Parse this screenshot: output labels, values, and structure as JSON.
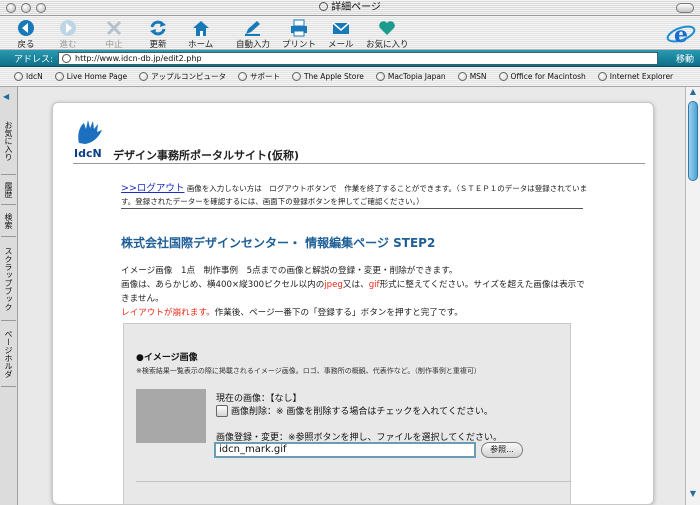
{
  "window": {
    "title": "詳細ページ"
  },
  "toolbar": {
    "back": "戻る",
    "forward": "進む",
    "stop": "中止",
    "refresh": "更新",
    "home": "ホーム",
    "autofill": "自動入力",
    "print": "プリント",
    "mail": "メール",
    "favorites": "お気に入り"
  },
  "address": {
    "label": "アドレス:",
    "url": "http://www.idcn-db.jp/edit2.php",
    "go": "移動"
  },
  "favbar": {
    "items": [
      "IdcN",
      "Live Home Page",
      "アップルコンピュータ",
      "サポート",
      "The Apple Store",
      "MacTopia Japan",
      "MSN",
      "Office for Macintosh",
      "Internet Explorer"
    ]
  },
  "sidebar": {
    "tabs": [
      "お気に入り",
      "履歴",
      "検索",
      "スクラップブック",
      "ページホルダ"
    ]
  },
  "page": {
    "logo_text": "IdcN",
    "site_title": "デザイン事務所ポータルサイト(仮称)",
    "logout_link": ">>ログアウト",
    "logout_desc": "画像を入力しない方は　ログアウトボタンで　作業を終了することができます。（ＳＴＥＰ１のデータは登録されています。登録されたデーターを確認するには、画面下の登録ボタンを押してご確認ください。）",
    "section_title": "株式会社国際デザインセンター・ 情報編集ページ STEP2",
    "intro1": "イメージ画像　1点　制作事例　5点までの画像と解説の登録・変更・削除ができます。",
    "intro2a": "画像は、あらかじめ、横400×縦300ピクセル以内の",
    "intro2_jpeg": "jpeg",
    "intro2b": "又は、",
    "intro2_gif": "gif",
    "intro2c": "形式に整えてください。サイズを超えた画像は表示できません。",
    "intro3_red": "レイアウトが崩れます。",
    "intro3b": "作業後、ページ一番下の「登録する」ボタンを押すと完了です。"
  },
  "form": {
    "heading": "●イメージ画像",
    "note": "※検索結果一覧表示の際に掲載されるイメージ画像。ロゴ、事務所の概観、代表作など。（制作事例と重複可）",
    "current": "現在の画像：【なし】",
    "delete_label": "画像削除：※ 画像を削除する場合はチェックを入れてください。",
    "upload_label": "画像登録・変更：※参照ボタンを押し、ファイルを選択してください。",
    "file_value": "idcn_mark.gif",
    "browse": "参照..."
  }
}
